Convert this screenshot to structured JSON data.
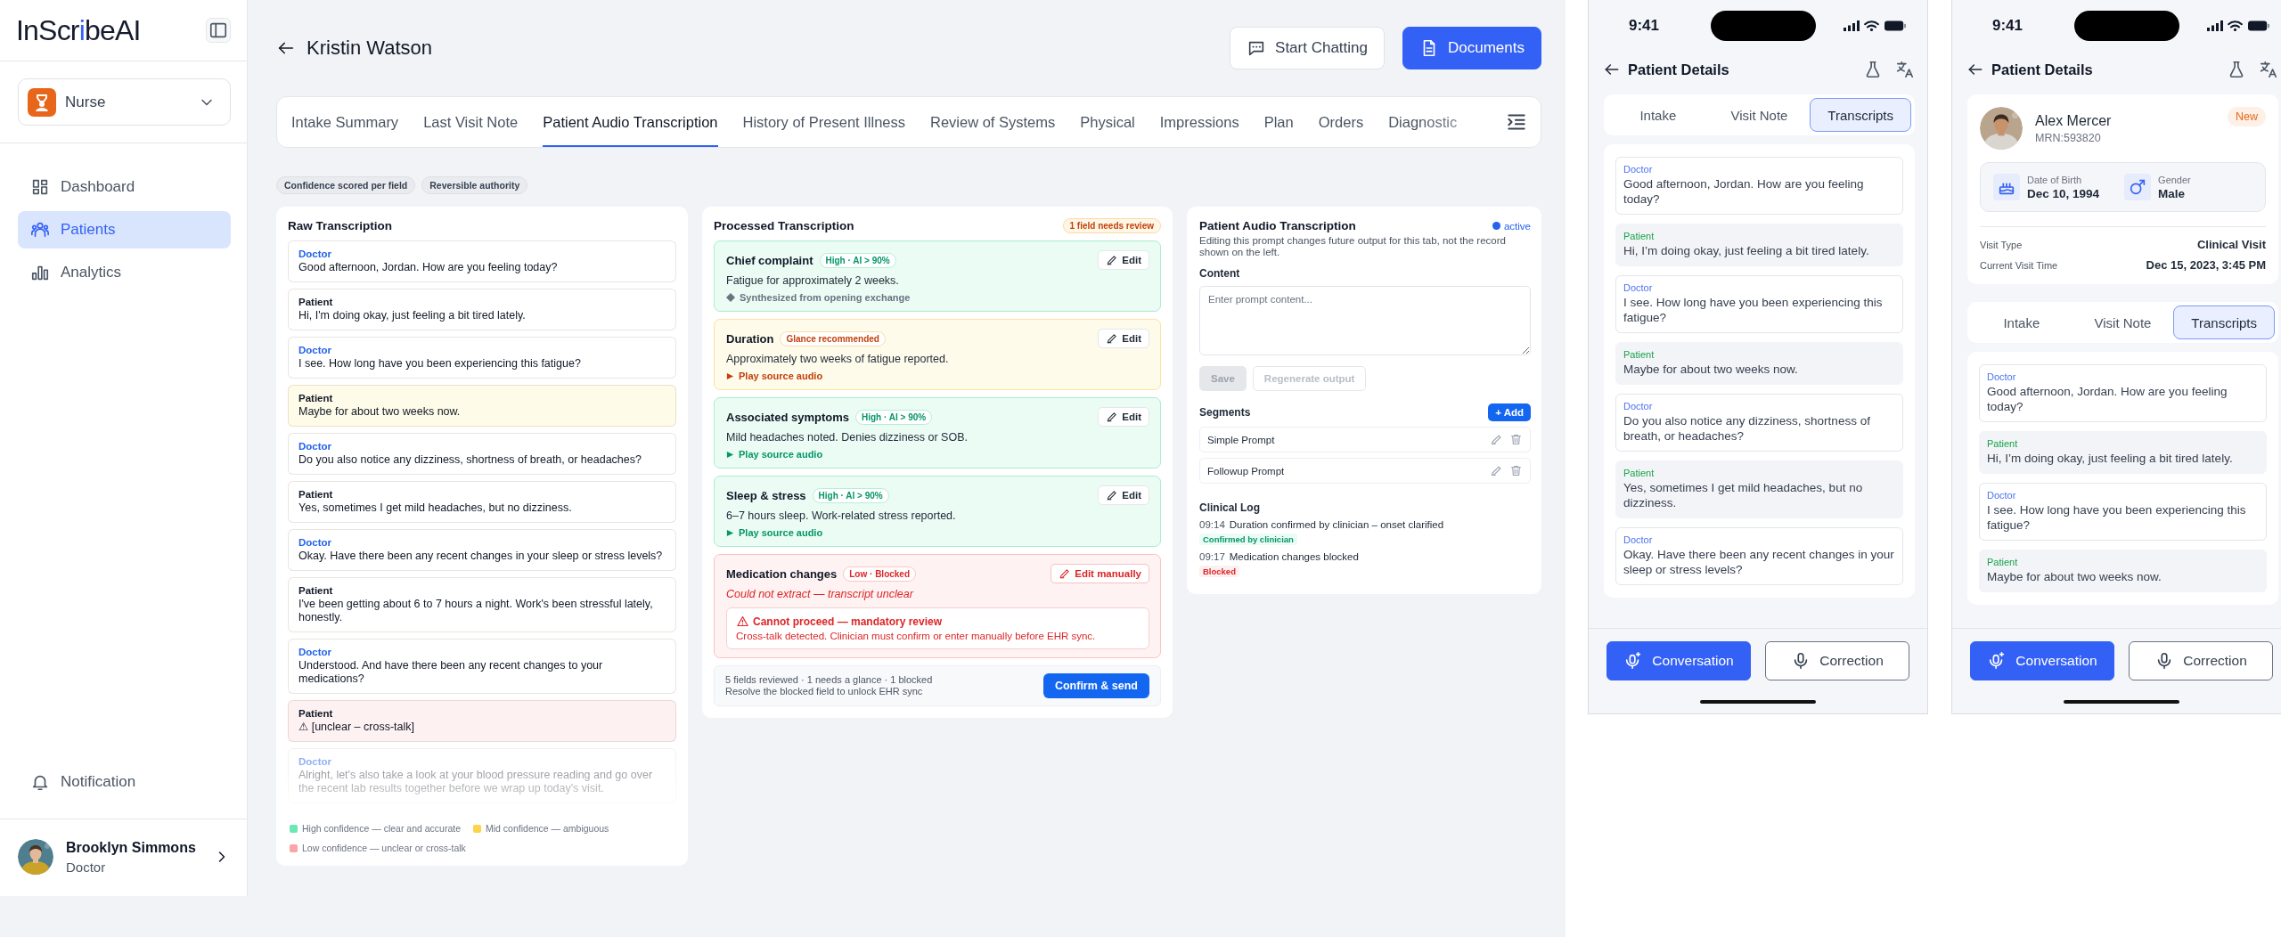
{
  "sidebar": {
    "logo": [
      {
        "text": "InScr",
        "accent": false
      },
      {
        "text": "i",
        "accent": true
      },
      {
        "text": "beAI",
        "accent": false
      }
    ],
    "role": "Nurse",
    "nav": [
      {
        "label": "Dashboard",
        "selected": false
      },
      {
        "label": "Patients",
        "selected": true
      },
      {
        "label": "Analytics",
        "selected": false
      }
    ],
    "notification": "Notification",
    "user": {
      "name": "Brooklyn Simmons",
      "role": "Doctor"
    }
  },
  "header": {
    "title": "Kristin Watson",
    "buttons": [
      {
        "label": "Start Chatting",
        "kind": "secondary"
      },
      {
        "label": "Documents",
        "kind": "primary"
      }
    ]
  },
  "tabs": [
    {
      "label": "Intake Summary",
      "selected": false
    },
    {
      "label": "Last Visit Note",
      "selected": false
    },
    {
      "label": "Patient Audio Transcription",
      "selected": true
    },
    {
      "label": "History of Present Illness",
      "selected": false
    },
    {
      "label": "Review of Systems",
      "selected": false
    },
    {
      "label": "Physical",
      "selected": false
    },
    {
      "label": "Impressions",
      "selected": false
    },
    {
      "label": "Plan",
      "selected": false
    },
    {
      "label": "Orders",
      "selected": false
    },
    {
      "label": "Diagnostic",
      "selected": false
    }
  ],
  "chips": [
    "Confidence scored per field",
    "Reversible authority"
  ],
  "raw_transcription": {
    "title": "Raw Transcription",
    "messages": [
      {
        "speaker": "Doctor",
        "kind": "doctor",
        "color": "#ffffff",
        "text": "Good afternoon, Jordan. How are you feeling today?"
      },
      {
        "speaker": "Patient",
        "kind": "patient",
        "color": "#ffffff",
        "text": "Hi, I'm doing okay, just feeling a bit tired lately."
      },
      {
        "speaker": "Doctor",
        "kind": "doctor",
        "color": "#ffffff",
        "text": "I see. How long have you been experiencing this fatigue?"
      },
      {
        "speaker": "Patient",
        "kind": "patient",
        "color": "#fefbe8",
        "text": "Maybe for about two weeks now."
      },
      {
        "speaker": "Doctor",
        "kind": "doctor",
        "color": "#ffffff",
        "text": "Do you also notice any dizziness, shortness of breath, or headaches?"
      },
      {
        "speaker": "Patient",
        "kind": "patient",
        "color": "#ffffff",
        "text": "Yes, sometimes I get mild headaches, but no dizziness."
      },
      {
        "speaker": "Doctor",
        "kind": "doctor",
        "color": "#ffffff",
        "text": "Okay. Have there been any recent changes in your sleep or stress levels?"
      },
      {
        "speaker": "Patient",
        "kind": "patient",
        "color": "#ffffff",
        "text": "I've been getting about 6 to 7 hours a night. Work's been stressful lately, honestly."
      },
      {
        "speaker": "Doctor",
        "kind": "doctor",
        "color": "#ffffff",
        "text": "Understood. And have there been any recent changes to your medications?"
      },
      {
        "speaker": "Patient",
        "kind": "patient",
        "color": "#fef1f1",
        "text": "⚠ [unclear – cross-talk]"
      },
      {
        "speaker": "Doctor",
        "kind": "doctor",
        "color": "#ffffff",
        "text": "Alright, let's also take a look at your blood pressure reading and go over the recent lab results together before we wrap up today's visit."
      }
    ],
    "legend": [
      {
        "label": "High confidence — clear and accurate",
        "color": "#6ee7b7"
      },
      {
        "label": "Mid confidence — ambiguous",
        "color": "#fcd34d"
      },
      {
        "label": "Low confidence — unclear or cross-talk",
        "color": "#fca5a5"
      }
    ]
  },
  "processed_transcription": {
    "title": "Processed Transcription",
    "badge": "1 field needs review",
    "fields": [
      {
        "label": "Chief complaint",
        "kind": "high",
        "tag": "High · AI > 90%",
        "value": "Fatigue for approximately 2 weeks.",
        "note": {
          "kind": "source",
          "text": "Synthesized from opening exchange"
        },
        "edit": "Edit"
      },
      {
        "label": "Duration",
        "kind": "mid",
        "tag": "Glance recommended",
        "value": "Approximately two weeks of fatigue reported.",
        "note": {
          "kind": "audio",
          "text": "Play source audio"
        },
        "edit": "Edit"
      },
      {
        "label": "Associated symptoms",
        "kind": "high",
        "tag": "High · AI > 90%",
        "value": "Mild headaches noted. Denies dizziness or SOB.",
        "note": {
          "kind": "audio",
          "text": "Play source audio"
        },
        "edit": "Edit"
      },
      {
        "label": "Sleep & stress",
        "kind": "high",
        "tag": "High · AI > 90%",
        "value": "6–7 hours sleep. Work-related stress reported.",
        "note": {
          "kind": "audio",
          "text": "Play source audio"
        },
        "edit": "Edit"
      },
      {
        "label": "Medication changes",
        "kind": "low",
        "tag": "Low · Blocked",
        "value": "Could not extract — transcript unclear",
        "edit": "Edit manually",
        "alert": {
          "title": "Cannot proceed — mandatory review",
          "text": "Cross-talk detected. Clinician must confirm or enter manually before EHR sync."
        }
      }
    ],
    "summary": [
      "5 fields reviewed · 1 needs a glance · 1 blocked",
      "Resolve the blocked field to unlock EHR sync"
    ],
    "confirm": "Confirm & send"
  },
  "prompt_panel": {
    "title": "Patient Audio Transcription",
    "status": "active",
    "description": "Editing this prompt changes future output for this tab, not the record shown on the left.",
    "content_label": "Content",
    "placeholder": "Enter prompt content...",
    "buttons": [
      {
        "label": "Save",
        "kind": "filled",
        "disabled": true
      },
      {
        "label": "Regenerate output",
        "kind": "outline",
        "disabled": true
      }
    ],
    "segments_label": "Segments",
    "add": "+ Add",
    "segments": [
      "Simple Prompt",
      "Followup Prompt"
    ],
    "log_label": "Clinical Log",
    "log": [
      {
        "time": "09:14",
        "text": "Duration confirmed by clinician – onset clarified",
        "tag": "Confirmed by clinician",
        "kind": "confirmed"
      },
      {
        "time": "09:17",
        "text": "Medication changes blocked",
        "tag": "Blocked",
        "kind": "blocked"
      }
    ]
  },
  "phones": [
    {
      "time": "9:41",
      "title": "Patient Details",
      "tabs": [
        {
          "label": "Intake",
          "selected": false
        },
        {
          "label": "Visit Note",
          "selected": false
        },
        {
          "label": "Transcripts",
          "selected": true
        }
      ],
      "messages": [
        {
          "speaker": "Doctor",
          "kind": "doctor",
          "text": "Good afternoon, Jordan. How are you feeling today?"
        },
        {
          "speaker": "Patient",
          "kind": "patient",
          "text": "Hi, I’m doing okay, just feeling a bit tired lately."
        },
        {
          "speaker": "Doctor",
          "kind": "doctor",
          "text": "I see. How long have you been experiencing this fatigue?"
        },
        {
          "speaker": "Patient",
          "kind": "patient",
          "text": "Maybe for about two weeks now."
        },
        {
          "speaker": "Doctor",
          "kind": "doctor",
          "text": "Do you also notice any dizziness, shortness of breath, or headaches?"
        },
        {
          "speaker": "Patient",
          "kind": "patient",
          "text": "Yes, sometimes I get mild headaches, but no dizziness."
        },
        {
          "speaker": "Doctor",
          "kind": "doctor",
          "text": "Okay. Have there been any recent changes in your sleep or stress levels?"
        }
      ],
      "buttons": [
        {
          "label": "Conversation",
          "kind": "primary"
        },
        {
          "label": "Correction",
          "kind": "outline"
        }
      ]
    },
    {
      "time": "9:41",
      "title": "Patient Details",
      "patient": {
        "name": "Alex Mercer",
        "mrn": "MRN:593820",
        "badge": "New",
        "dob_label": "Date of Birth",
        "dob": "Dec 10, 1994",
        "gender_label": "Gender",
        "gender": "Male",
        "visit": [
          {
            "label": "Visit Type",
            "value": "Clinical Visit"
          },
          {
            "label": "Current Visit Time",
            "value": "Dec 15, 2023, 3:45 PM"
          }
        ]
      },
      "tabs": [
        {
          "label": "Intake",
          "selected": false
        },
        {
          "label": "Visit Note",
          "selected": false
        },
        {
          "label": "Transcripts",
          "selected": true
        }
      ],
      "messages": [
        {
          "speaker": "Doctor",
          "kind": "doctor",
          "text": "Good afternoon, Jordan. How are you feeling today?"
        },
        {
          "speaker": "Patient",
          "kind": "patient",
          "text": "Hi, I’m doing okay, just feeling a bit tired lately."
        },
        {
          "speaker": "Doctor",
          "kind": "doctor",
          "text": "I see. How long have you been experiencing this fatigue?"
        },
        {
          "speaker": "Patient",
          "kind": "patient",
          "text": "Maybe for about two weeks now."
        }
      ],
      "buttons": [
        {
          "label": "Conversation",
          "kind": "primary"
        },
        {
          "label": "Correction",
          "kind": "outline"
        }
      ]
    }
  ]
}
